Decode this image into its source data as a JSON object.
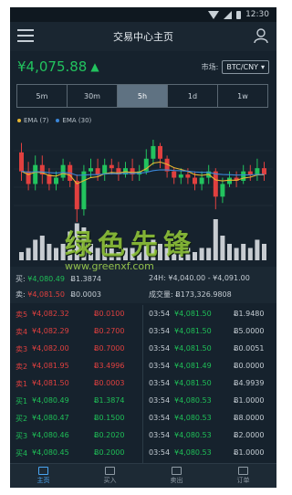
{
  "status": {
    "time": "12:30"
  },
  "header": {
    "title": "交易中心主页"
  },
  "price": {
    "value": "¥4,075.88"
  },
  "market": {
    "label": "市场:",
    "selected": "BTC/CNY"
  },
  "tabs": [
    "5m",
    "30m",
    "5h",
    "1d",
    "1w"
  ],
  "active_tab": "5h",
  "legend": {
    "ema7": "EMA (7)",
    "ema30": "EMA (30)"
  },
  "colors": {
    "up": "#22c35e",
    "down": "#e0403f",
    "ema7": "#e7b632",
    "ema30": "#3a86d8",
    "accent": "#4aa6f3"
  },
  "ticker": {
    "buy_label": "买:",
    "buy_price": "¥4,080.49",
    "buy_amount": "Ƀ1.3874",
    "sell_label": "卖:",
    "sell_price": "¥4,081.50",
    "sell_amount": "Ƀ0.0003",
    "range": "24H: ¥4,040.00 - ¥4,091.00",
    "volume": "成交量: Ƀ173,326.9808"
  },
  "orderbook": [
    {
      "label": "卖5",
      "price": "¥4,082.32",
      "amount": "Ƀ0.0100",
      "side": "sell"
    },
    {
      "label": "卖4",
      "price": "¥4,082.29",
      "amount": "Ƀ0.2700",
      "side": "sell"
    },
    {
      "label": "卖3",
      "price": "¥4,082.00",
      "amount": "Ƀ0.7000",
      "side": "sell"
    },
    {
      "label": "卖2",
      "price": "¥4,081.95",
      "amount": "Ƀ3.4996",
      "side": "sell"
    },
    {
      "label": "卖1",
      "price": "¥4,081.50",
      "amount": "Ƀ0.0003",
      "side": "sell"
    },
    {
      "label": "买1",
      "price": "¥4,080.49",
      "amount": "Ƀ1.3874",
      "side": "buy"
    },
    {
      "label": "买2",
      "price": "¥4,080.47",
      "amount": "Ƀ0.1500",
      "side": "buy"
    },
    {
      "label": "买3",
      "price": "¥4,080.46",
      "amount": "Ƀ0.2020",
      "side": "buy"
    },
    {
      "label": "买4",
      "price": "¥4,080.45",
      "amount": "Ƀ0.2000",
      "side": "buy"
    }
  ],
  "trades": [
    {
      "time": "03:54",
      "price": "¥4,081.50",
      "amount": "Ƀ1.9480",
      "side": "buy"
    },
    {
      "time": "03:54",
      "price": "¥4,081.50",
      "amount": "Ƀ5.0000",
      "side": "buy"
    },
    {
      "time": "03:54",
      "price": "¥4,081.50",
      "amount": "Ƀ0.0051",
      "side": "buy"
    },
    {
      "time": "03:54",
      "price": "¥4,081.49",
      "amount": "Ƀ0.0000",
      "side": "buy"
    },
    {
      "time": "03:54",
      "price": "¥4,081.50",
      "amount": "Ƀ4.9939",
      "side": "buy"
    },
    {
      "time": "03:54",
      "price": "¥4,080.53",
      "amount": "Ƀ1.0000",
      "side": "buy"
    },
    {
      "time": "03:54",
      "price": "¥4,080.53",
      "amount": "Ƀ8.0000",
      "side": "buy"
    },
    {
      "time": "03:54",
      "price": "¥4,080.53",
      "amount": "Ƀ2.0000",
      "side": "buy"
    },
    {
      "time": "03:54",
      "price": "¥4,080.53",
      "amount": "Ƀ1.0000",
      "side": "buy"
    }
  ],
  "candles": [
    {
      "o": 3.0,
      "c": 1.8,
      "h": 3.6,
      "l": 1.2,
      "v": 2
    },
    {
      "o": 1.8,
      "c": 1.0,
      "h": 2.4,
      "l": 0.6,
      "v": 3
    },
    {
      "o": 1.0,
      "c": 2.2,
      "h": 2.8,
      "l": 0.6,
      "v": 5
    },
    {
      "o": 2.2,
      "c": 1.6,
      "h": 2.8,
      "l": 1.0,
      "v": 6
    },
    {
      "o": 1.6,
      "c": 1.0,
      "h": 2.0,
      "l": 0.6,
      "v": 4
    },
    {
      "o": 1.0,
      "c": 1.4,
      "h": 1.8,
      "l": 0.6,
      "v": 3
    },
    {
      "o": 1.4,
      "c": 2.2,
      "h": 2.6,
      "l": 1.2,
      "v": 4
    },
    {
      "o": 2.2,
      "c": 1.2,
      "h": 2.4,
      "l": 0.8,
      "v": 7
    },
    {
      "o": 1.2,
      "c": -0.6,
      "h": 1.6,
      "l": -1.4,
      "v": 9
    },
    {
      "o": -0.6,
      "c": 1.8,
      "h": 2.2,
      "l": -1.0,
      "v": 8
    },
    {
      "o": 1.8,
      "c": 2.0,
      "h": 2.6,
      "l": 1.4,
      "v": 4
    },
    {
      "o": 2.0,
      "c": 1.6,
      "h": 2.6,
      "l": 1.2,
      "v": 3
    },
    {
      "o": 1.6,
      "c": 2.2,
      "h": 2.6,
      "l": 1.2,
      "v": 4
    },
    {
      "o": 2.2,
      "c": 2.0,
      "h": 2.6,
      "l": 1.6,
      "v": 3
    },
    {
      "o": 2.0,
      "c": 1.6,
      "h": 2.4,
      "l": 1.2,
      "v": 2
    },
    {
      "o": 1.6,
      "c": 2.0,
      "h": 2.4,
      "l": 1.4,
      "v": 3
    },
    {
      "o": 2.0,
      "c": 1.6,
      "h": 2.6,
      "l": 1.2,
      "v": 3
    },
    {
      "o": 1.6,
      "c": 1.8,
      "h": 2.2,
      "l": 1.2,
      "v": 2
    },
    {
      "o": 1.8,
      "c": 2.6,
      "h": 3.2,
      "l": 1.6,
      "v": 4
    },
    {
      "o": 2.6,
      "c": 3.4,
      "h": 3.8,
      "l": 2.2,
      "v": 5
    },
    {
      "o": 3.4,
      "c": 2.6,
      "h": 3.6,
      "l": 2.0,
      "v": 4
    },
    {
      "o": 2.6,
      "c": 1.8,
      "h": 2.8,
      "l": 1.4,
      "v": 3
    },
    {
      "o": 1.8,
      "c": 1.4,
      "h": 2.0,
      "l": 1.0,
      "v": 2
    },
    {
      "o": 1.4,
      "c": 1.6,
      "h": 2.0,
      "l": 1.0,
      "v": 2
    },
    {
      "o": 1.6,
      "c": 1.4,
      "h": 2.0,
      "l": 1.0,
      "v": 3
    },
    {
      "o": 1.4,
      "c": 1.0,
      "h": 1.8,
      "l": 0.6,
      "v": 2
    },
    {
      "o": 1.0,
      "c": 1.4,
      "h": 1.8,
      "l": 0.6,
      "v": 3
    },
    {
      "o": 1.4,
      "c": 1.8,
      "h": 2.2,
      "l": 1.0,
      "v": 3
    },
    {
      "o": 1.8,
      "c": 0.2,
      "h": 2.0,
      "l": -0.6,
      "v": 10
    },
    {
      "o": 0.2,
      "c": 1.0,
      "h": 1.4,
      "l": -0.2,
      "v": 6
    },
    {
      "o": 1.0,
      "c": 1.4,
      "h": 1.8,
      "l": 0.8,
      "v": 4
    },
    {
      "o": 1.4,
      "c": 1.2,
      "h": 1.8,
      "l": 0.8,
      "v": 3
    },
    {
      "o": 1.2,
      "c": 1.8,
      "h": 2.2,
      "l": 1.0,
      "v": 4
    },
    {
      "o": 1.8,
      "c": 1.6,
      "h": 2.2,
      "l": 1.2,
      "v": 3
    },
    {
      "o": 1.6,
      "c": 2.0,
      "h": 2.6,
      "l": 1.2,
      "v": 5
    },
    {
      "o": 2.0,
      "c": 1.6,
      "h": 2.4,
      "l": 1.2,
      "v": 4
    }
  ],
  "watermark": {
    "text": "绿色先锋",
    "url": "www.greenxf.com"
  },
  "nav": [
    "主页",
    "买入",
    "卖出",
    "订单"
  ]
}
